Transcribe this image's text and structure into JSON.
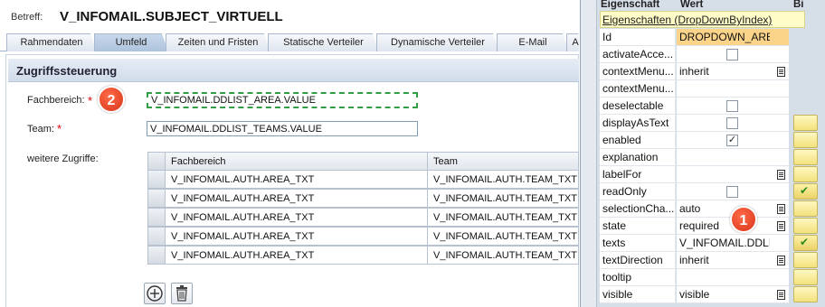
{
  "header": {
    "betreff_label": "Betreff:",
    "betreff_value": "V_INFOMAIL.SUBJECT_VIRTUELL"
  },
  "tabs": [
    {
      "label": "Rahmendaten"
    },
    {
      "label": "Umfeld"
    },
    {
      "label": "Zeiten und Fristen"
    },
    {
      "label": "Statische Verteiler"
    },
    {
      "label": "Dynamische Verteiler"
    },
    {
      "label": "E-Mail"
    },
    {
      "label": "A"
    }
  ],
  "section": {
    "title": "Zugriffssteuerung"
  },
  "form": {
    "fachbereich_label": "Fachbereich:",
    "fachbereich_required": "*",
    "fachbereich_value": "V_INFOMAIL.DDLIST_AREA.VALUE",
    "team_label": "Team:",
    "team_required": "*",
    "team_value": "V_INFOMAIL.DDLIST_TEAMS.VALUE",
    "weitere_label": "weitere Zugriffe:"
  },
  "badges": {
    "left": "2",
    "right": "1"
  },
  "table": {
    "columns": [
      "Fachbereich",
      "Team"
    ],
    "rows": [
      [
        "V_INFOMAIL.AUTH.AREA_TXT",
        "V_INFOMAIL.AUTH.TEAM_TXT"
      ],
      [
        "V_INFOMAIL.AUTH.AREA_TXT",
        "V_INFOMAIL.AUTH.TEAM_TXT"
      ],
      [
        "V_INFOMAIL.AUTH.AREA_TXT",
        "V_INFOMAIL.AUTH.TEAM_TXT"
      ],
      [
        "V_INFOMAIL.AUTH.AREA_TXT",
        "V_INFOMAIL.AUTH.TEAM_TXT"
      ],
      [
        "V_INFOMAIL.AUTH.AREA_TXT",
        "V_INFOMAIL.AUTH.TEAM_TXT"
      ]
    ]
  },
  "properties": {
    "col_eigenschaft": "Eigenschaft",
    "col_wert": "Wert",
    "col_bi": "Bi",
    "subheader": "Eigenschaften (DropDownByIndex)",
    "rows": [
      {
        "name": "Id",
        "value": "DROPDOWN_AREA",
        "highlight": true
      },
      {
        "name": "activateAcce...",
        "checkbox": false
      },
      {
        "name": "contextMenu...",
        "value": "inherit",
        "mini": true
      },
      {
        "name": "contextMenu...",
        "value": ""
      },
      {
        "name": "deselectable",
        "checkbox": false
      },
      {
        "name": "displayAsText",
        "checkbox": false,
        "button": true
      },
      {
        "name": "enabled",
        "checkbox": true,
        "button": true
      },
      {
        "name": "explanation",
        "value": "",
        "button": true
      },
      {
        "name": "labelFor",
        "value": "",
        "mini": true,
        "button": true
      },
      {
        "name": "readOnly",
        "checkbox": false,
        "button": "check"
      },
      {
        "name": "selectionCha...",
        "value": "auto",
        "mini": true,
        "button": true
      },
      {
        "name": "state",
        "value": "required",
        "mini": true,
        "button": true
      },
      {
        "name": "texts",
        "value": "V_INFOMAIL.DDLIST...",
        "button": "check"
      },
      {
        "name": "textDirection",
        "value": "inherit",
        "mini": true,
        "button": true
      },
      {
        "name": "tooltip",
        "value": "",
        "button": true
      },
      {
        "name": "visible",
        "value": "visible",
        "mini": true,
        "button": true
      }
    ]
  }
}
